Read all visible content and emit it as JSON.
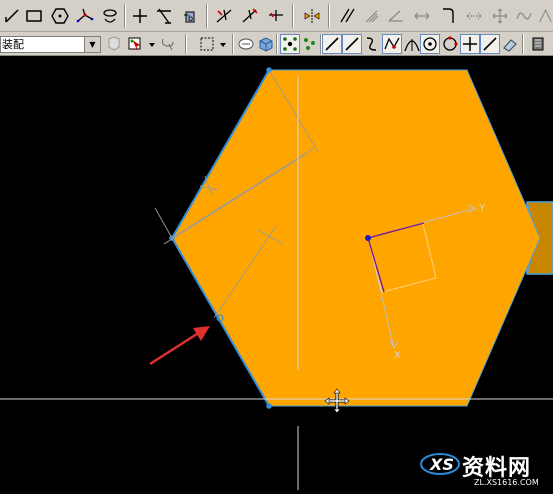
{
  "toolbar_top": {
    "icons": [
      "line-icon",
      "rectangle-icon",
      "hexagon-icon",
      "spline-icon",
      "ellipse-icon",
      "point-icon",
      "trim-icon",
      "symbol-icon",
      "extend-icon",
      "dimension-icon",
      "divide-icon",
      "mirror-icon",
      "horizontal-constraint-icon",
      "angle-icon",
      "horizontal-arrows-icon",
      "fillet-icon",
      "move-icon",
      "cross-arrows-icon",
      "curve-icon",
      "arc-tool-icon"
    ]
  },
  "toolbar_bottom": {
    "assembly_filter": "装配",
    "icons": [
      "component-icon",
      "select-filter-icon",
      "box-select-icon",
      "lasso-icon",
      "shade-icon",
      "solid-icon",
      "snap-grid-icon",
      "snap-point-icon",
      "line-snap-icon",
      "slash-icon",
      "end-point-icon",
      "mid-point-icon",
      "tangent-icon",
      "center-icon",
      "quadrant-icon",
      "intersection-icon",
      "perpendicular-icon",
      "angle-snap-icon",
      "render-icon"
    ]
  },
  "canvas": {
    "background": "#000000",
    "shape_fill": "#ffa500",
    "edge_color": "#4fa3d8",
    "highlight_color": "#e03030",
    "axis_labels": {
      "y": "Y",
      "x": "X"
    }
  },
  "watermark": {
    "brand": "资料网",
    "site": "ZL.XS1616.COM"
  }
}
